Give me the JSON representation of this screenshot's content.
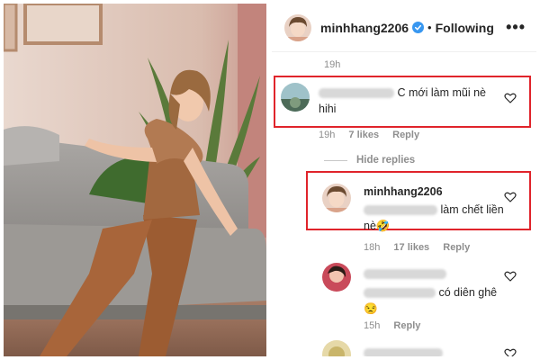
{
  "header": {
    "username": "minhhang2206",
    "dot": "•",
    "following_label": "Following",
    "more_label": "•••"
  },
  "top_meta": {
    "time": "19h"
  },
  "comment1": {
    "text": "C mới làm mũi nè hihi",
    "time": "19h",
    "likes": "7 likes",
    "reply": "Reply"
  },
  "hide_replies": "Hide replies",
  "reply1": {
    "username": "minhhang2206",
    "text": "làm chết liền nè🤣",
    "time": "18h",
    "likes": "17 likes",
    "reply": "Reply"
  },
  "comment2": {
    "text": "có diên ghê 😒",
    "time": "15h",
    "reply": "Reply"
  },
  "colors": {
    "highlight_border": "#e0242b",
    "verified_blue": "#3897f0",
    "muted": "#8e8e8e"
  }
}
